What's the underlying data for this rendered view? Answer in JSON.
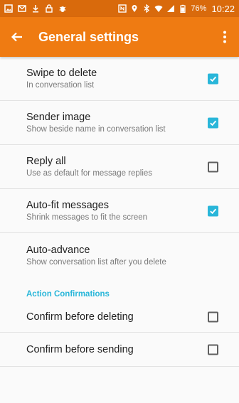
{
  "status_bar": {
    "icons_left": [
      "image-icon",
      "email-icon",
      "download-icon",
      "lock-icon",
      "bug-icon"
    ],
    "icons_right": [
      "nfc-icon",
      "location-icon",
      "bluetooth-icon",
      "wifi-icon",
      "signal-icon",
      "battery-icon"
    ],
    "battery": "76%",
    "time": "10:22"
  },
  "toolbar": {
    "title": "General settings",
    "back_icon": "arrow-back-icon",
    "menu_icon": "more-vert-icon"
  },
  "settings": [
    {
      "title": "Swipe to delete",
      "subtitle": "In conversation list",
      "checked": true
    },
    {
      "title": "Sender image",
      "subtitle": "Show beside name in conversation list",
      "checked": true
    },
    {
      "title": "Reply all",
      "subtitle": "Use as default for message replies",
      "checked": false
    },
    {
      "title": "Auto-fit messages",
      "subtitle": "Shrink messages to fit the screen",
      "checked": true
    },
    {
      "title": "Auto-advance",
      "subtitle": "Show conversation list after you delete",
      "checked": null
    }
  ],
  "section": {
    "header": "Action Confirmations",
    "items": [
      {
        "title": "Confirm before deleting",
        "checked": false
      },
      {
        "title": "Confirm before sending",
        "checked": false
      }
    ]
  },
  "colors": {
    "status_bar": "#d96a0c",
    "toolbar": "#ef7b12",
    "accent": "#29b6d9"
  }
}
